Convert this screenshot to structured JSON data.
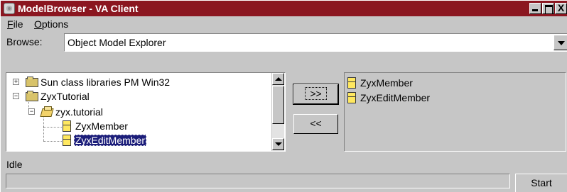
{
  "window": {
    "title": "ModelBrowser - VA Client",
    "controls": {
      "close_glyph": "X"
    }
  },
  "menu": {
    "file": {
      "mnemonic": "F",
      "rest": "ile"
    },
    "options": {
      "mnemonic": "O",
      "rest": "ptions"
    }
  },
  "browse": {
    "label": "Browse:",
    "value": "Object Model Explorer"
  },
  "tree": {
    "items": [
      {
        "label": "Sun class libraries PM Win32",
        "expander": "+",
        "icon": "folder-icon",
        "level": 0
      },
      {
        "label": "ZyxTutorial",
        "expander": "−",
        "icon": "folder-icon",
        "level": 0
      },
      {
        "label": "zyx.tutorial",
        "expander": "−",
        "icon": "package-icon",
        "level": 1
      },
      {
        "label": "ZyxMember",
        "icon": "class-icon",
        "level": 2
      },
      {
        "label": "ZyxEditMember",
        "icon": "class-icon",
        "level": 2,
        "selected": true
      }
    ]
  },
  "buttons": {
    "add": ">>",
    "remove": "<<",
    "start": "Start"
  },
  "selected_list": {
    "items": [
      {
        "label": "ZyxMember",
        "icon": "class-icon"
      },
      {
        "label": "ZyxEditMember",
        "icon": "class-icon"
      }
    ]
  },
  "status": {
    "text": "Idle",
    "progress": 0
  },
  "colors": {
    "title_bar": "#8b1620",
    "selection": "#1c1e7a",
    "face": "#c6c6c6"
  }
}
